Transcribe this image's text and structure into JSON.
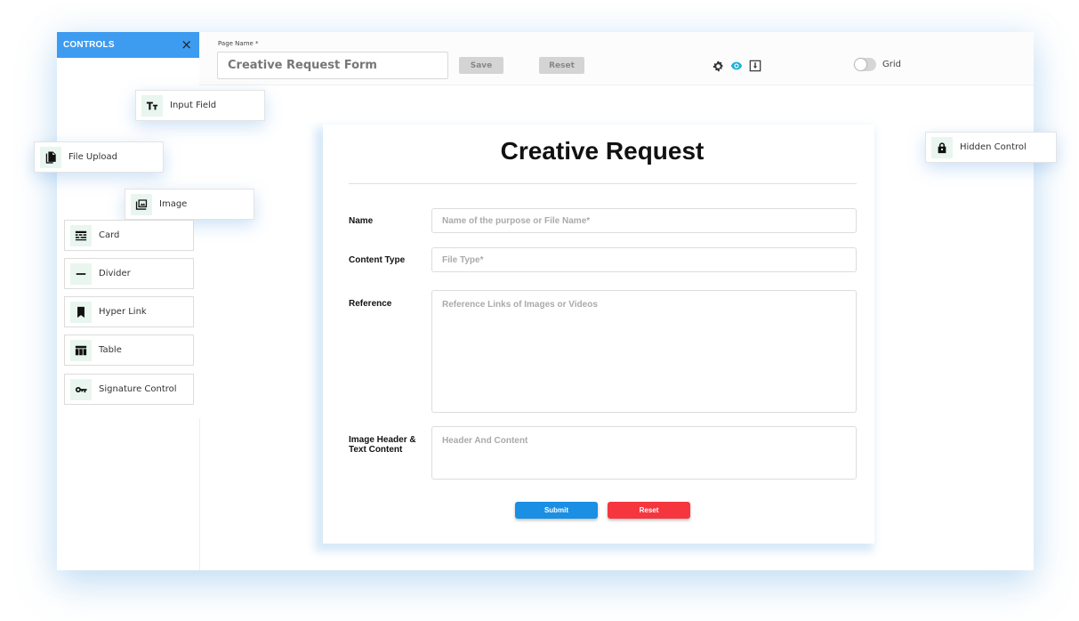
{
  "controls_panel": {
    "title": "CONTROLS",
    "close_label": "×",
    "items": [
      {
        "label": "Input Field",
        "icon": "text-icon"
      },
      {
        "label": "File Upload",
        "icon": "file-icon"
      },
      {
        "label": "Image",
        "icon": "image-icon"
      },
      {
        "label": "Card",
        "icon": "card-icon"
      },
      {
        "label": "Divider",
        "icon": "divider-icon"
      },
      {
        "label": "Hyper Link",
        "icon": "bookmark-icon"
      },
      {
        "label": "Table",
        "icon": "table-icon"
      },
      {
        "label": "Signature Control",
        "icon": "key-icon"
      },
      {
        "label": "Hidden Control",
        "icon": "lock-icon"
      }
    ]
  },
  "toolbar": {
    "page_name_label": "Page Name *",
    "page_name_value": "Creative Request Form",
    "save_label": "Save",
    "reset_label": "Reset",
    "grid_label": "Grid",
    "icons": [
      "gear-icon",
      "eye-icon",
      "download-icon"
    ],
    "accent_color": "#3d9bf0"
  },
  "form": {
    "title": "Creative Request",
    "fields": [
      {
        "label": "Name",
        "placeholder": "Name of the purpose or File Name*"
      },
      {
        "label": "Content Type",
        "placeholder": "File Type*"
      },
      {
        "label": "Reference",
        "placeholder": "Reference Links of Images or Videos"
      },
      {
        "label": "Image Header & Text Content",
        "placeholder": "Header And Content"
      }
    ],
    "submit_label": "Submit",
    "reset_label": "Reset",
    "submit_color": "#1a8fe3",
    "reset_color": "#f5363f"
  }
}
